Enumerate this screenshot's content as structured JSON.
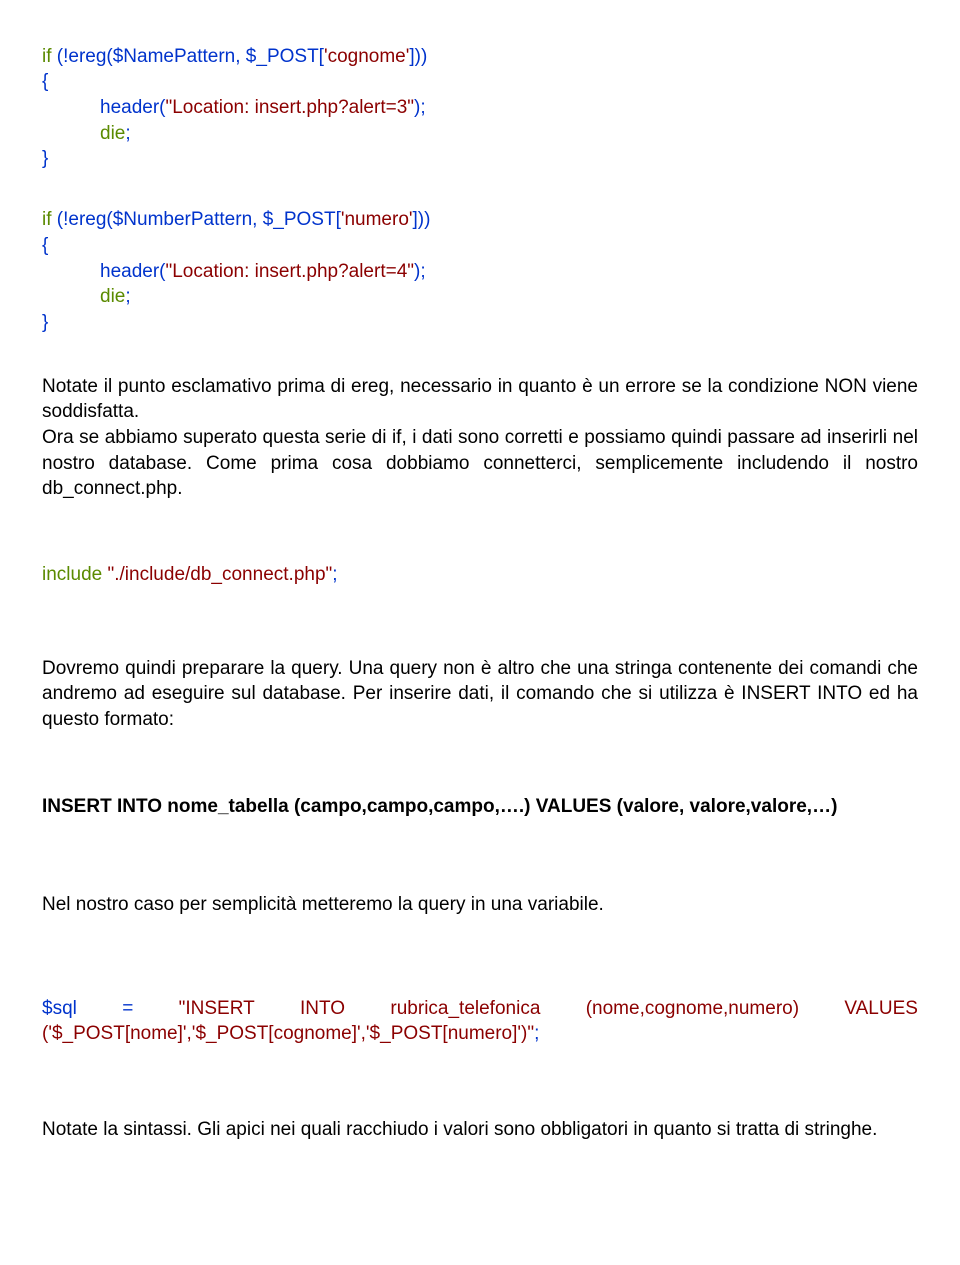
{
  "code1": {
    "l1": {
      "if": "if",
      "paren": " (!ereg($NamePattern, $_POST[",
      "str": "'cognome'",
      "close": "]))"
    },
    "l2": "{",
    "l3": {
      "header": "header",
      "paren": "(",
      "str": "\"Location: insert.php?alert=3\"",
      "close": ");"
    },
    "l4": {
      "die": "die",
      "semi": ";"
    },
    "l5": "}"
  },
  "code2": {
    "l1": {
      "if": "if",
      "paren": " (!ereg($NumberPattern, $_POST[",
      "str": "'numero'",
      "close": "]))"
    },
    "l2": "{",
    "l3": {
      "header": "header",
      "paren": "(",
      "str": "\"Location: insert.php?alert=4\"",
      "close": ");"
    },
    "l4": {
      "die": "die",
      "semi": ";"
    },
    "l5": "}"
  },
  "para1": "Notate il punto esclamativo prima di ereg, necessario in quanto è un errore se la condizione NON viene soddisfatta.",
  "para2": "Ora se abbiamo superato questa serie di if, i dati sono corretti e possiamo quindi passare ad inserirli nel nostro database. Come prima cosa dobbiamo connetterci, semplicemente includendo il nostro db_connect.php.",
  "code3": {
    "include": "include ",
    "str": "\"./include/db_connect.php\"",
    "semi": ";"
  },
  "para3": "Dovremo quindi preparare la query. Una query non è altro che una stringa contenente dei comandi che andremo ad eseguire sul database. Per inserire dati, il comando che si utilizza è INSERT INTO ed ha questo formato:",
  "bold1": "INSERT INTO nome_tabella (campo,campo,campo,….) VALUES (valore, valore,valore,…)",
  "para4": "Nel nostro caso per semplicità metteremo la query in una variabile.",
  "code4": {
    "l1a": "$sql",
    "l1b": "=",
    "l1c": "\"INSERT",
    "l1d": "INTO",
    "l1e": "rubrica_telefonica",
    "l1f": "(nome,cognome,numero)",
    "l1g": "VALUES",
    "l2": "('$_POST[nome]','$_POST[cognome]','$_POST[numero]')\"",
    "semi": ";"
  },
  "para5": "Notate la sintassi. Gli apici nei quali racchiudo i valori sono obbligatori in quanto si tratta di stringhe."
}
